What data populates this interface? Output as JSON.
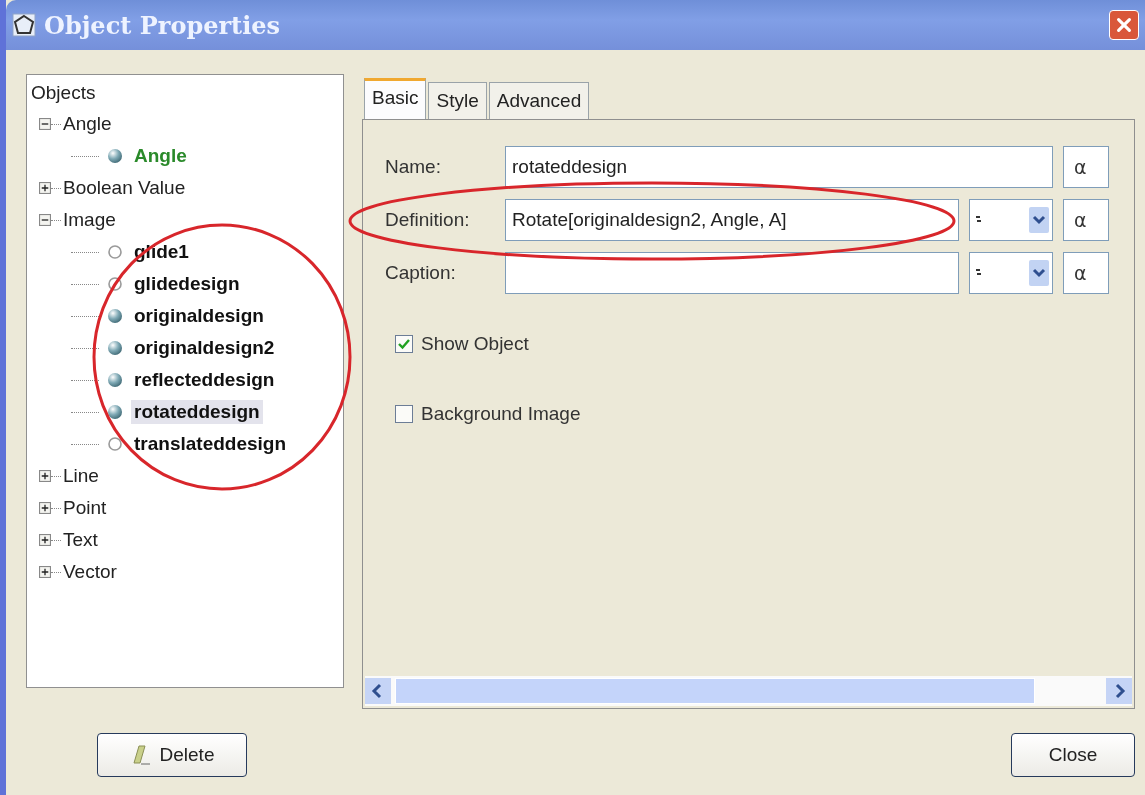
{
  "window": {
    "title": "Object Properties"
  },
  "tree": {
    "root": "Objects",
    "groups": [
      {
        "label": "Angle",
        "expanded": true,
        "children": [
          {
            "label": "Angle",
            "shown": true,
            "selected": false,
            "color": "#2a8a2a"
          }
        ]
      },
      {
        "label": "Boolean Value",
        "expanded": false
      },
      {
        "label": "Image",
        "expanded": true,
        "children": [
          {
            "label": "glide1",
            "shown": false,
            "selected": false,
            "color": "#111111"
          },
          {
            "label": "glidedesign",
            "shown": false,
            "selected": false,
            "color": "#111111"
          },
          {
            "label": "originaldesign",
            "shown": true,
            "selected": false,
            "color": "#111111"
          },
          {
            "label": "originaldesign2",
            "shown": true,
            "selected": false,
            "color": "#111111"
          },
          {
            "label": "reflecteddesign",
            "shown": true,
            "selected": false,
            "color": "#111111"
          },
          {
            "label": "rotateddesign",
            "shown": true,
            "selected": true,
            "color": "#111111"
          },
          {
            "label": "translateddesign",
            "shown": false,
            "selected": false,
            "color": "#111111"
          }
        ]
      },
      {
        "label": "Line",
        "expanded": false
      },
      {
        "label": "Point",
        "expanded": false
      },
      {
        "label": "Text",
        "expanded": false
      },
      {
        "label": "Vector",
        "expanded": false
      }
    ]
  },
  "tabs": [
    {
      "label": "Basic",
      "selected": true
    },
    {
      "label": "Style",
      "selected": false
    },
    {
      "label": "Advanced",
      "selected": false
    }
  ],
  "fields": [
    {
      "label": "Name:",
      "value": "rotateddesign",
      "has_combo": false,
      "alpha": "α"
    },
    {
      "label": "Definition:",
      "value": "Rotate[originaldesign2, Angle, A]",
      "has_combo": true,
      "alpha": "α"
    },
    {
      "label": "Caption:",
      "has_combo": true,
      "alpha": "α"
    }
  ],
  "checkboxes": [
    {
      "label": "Show Object",
      "checked": true
    },
    {
      "label": "Background Image",
      "checked": false
    }
  ],
  "buttons": {
    "delete": "Delete",
    "close": "Close"
  }
}
